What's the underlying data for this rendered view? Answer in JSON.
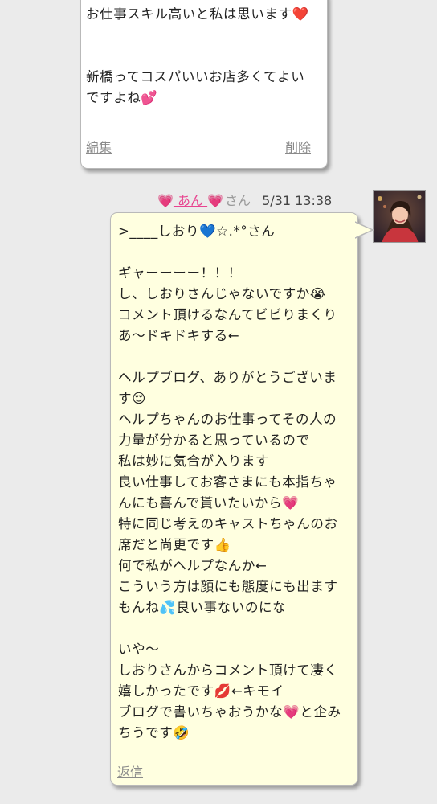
{
  "top_message": {
    "lines": [
      "お仕事スキル高いと私は思います❤️",
      "",
      "",
      "新橋ってコスパいいお店多くてよい",
      "ですよね💕"
    ],
    "edit_label": "編集",
    "delete_label": "削除"
  },
  "comment": {
    "author_prefix_emoji": "💗",
    "author_name": "あん",
    "author_suffix_emoji": "💗",
    "honorific": "さん",
    "datetime": "5/31 13:38",
    "lines": [
      ">____しおり💙☆.*°さん",
      "",
      "ギャーーーー！！！",
      "し、しおりさんじゃないですか😭",
      "コメント頂けるなんてビビりまくり",
      "あ〜ドキドキする←",
      "",
      "ヘルプブログ、ありがとうございま",
      "す😌",
      "ヘルプちゃんのお仕事ってその人の",
      "力量が分かると思っているので",
      "私は妙に気合が入ります",
      "良い仕事してお客さまにも本指ちゃ",
      "んにも喜んで貰いたいから💗",
      "特に同じ考えのキャストちゃんのお",
      "席だと尚更です👍",
      "何で私がヘルプなんか←",
      "こういう方は顔にも態度にも出ます",
      "もんね💦良い事ないのにな",
      "",
      "いや〜",
      "しおりさんからコメント頂けて凄く",
      "嬉しかったです💋←キモイ",
      "ブログで書いちゃおうかな💗と企み",
      "ちうです🤣"
    ],
    "reply_label": "返信"
  },
  "colors": {
    "comment_bg": "#ffffe0",
    "top_bg": "#ffffff",
    "accent_pink": "#e8438f",
    "link_gray": "#8a8a8a"
  }
}
